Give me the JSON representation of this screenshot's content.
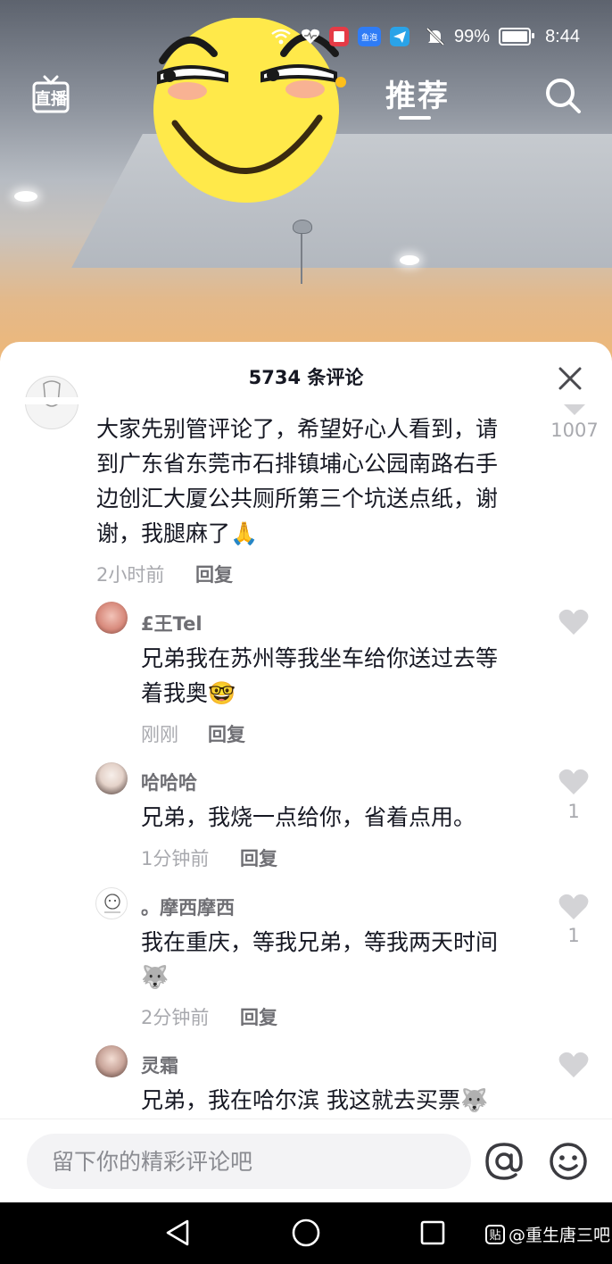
{
  "status_bar": {
    "battery": "99%",
    "time": "8:44"
  },
  "top_nav": {
    "live_label": "直播",
    "recommend_tab": "推荐"
  },
  "sheet": {
    "title": "5734 条评论"
  },
  "comments": [
    {
      "text_lines": [
        "大家先别管评论了，希望好心人看到，请",
        "到广东省东莞市石排镇埔心公园南路右手",
        "边创汇大厦公共厕所第三个坑送点纸，谢",
        "谢，我腿麻了🙏"
      ],
      "time": "2小时前",
      "reply_label": "回复",
      "likes": "1007"
    }
  ],
  "replies": [
    {
      "username": "£王Tel",
      "text_lines": [
        "兄弟我在苏州等我坐车给你送过去等",
        "着我奥🤓"
      ],
      "time": "刚刚",
      "reply_label": "回复",
      "likes": ""
    },
    {
      "username": "哈哈哈",
      "text_lines": [
        "兄弟，我烧一点给你，省着点用。"
      ],
      "time": "1分钟前",
      "reply_label": "回复",
      "likes": "1"
    },
    {
      "username": "。摩西摩西",
      "text_lines": [
        "我在重庆，等我兄弟，等我两天时间",
        "🐺"
      ],
      "time": "2分钟前",
      "reply_label": "回复",
      "likes": "1"
    },
    {
      "username": "灵霜",
      "text_lines": [
        "兄弟，我在哈尔滨 我这就去买票🐺"
      ],
      "time": "",
      "reply_label": "",
      "likes": ""
    }
  ],
  "input": {
    "placeholder": "留下你的精彩评论吧"
  },
  "watermark": {
    "logo": "贴",
    "text": "@重生唐三吧"
  },
  "icons": [
    "wifi-icon",
    "heart-rate-icon",
    "book-app-icon",
    "fish-app-icon",
    "paper-plane-icon",
    "mute-icon",
    "battery-icon",
    "live-icon",
    "search-icon",
    "close-icon",
    "heart-icon",
    "at-icon",
    "emoji-icon",
    "nav-back-icon",
    "nav-home-icon",
    "nav-recent-icon"
  ],
  "colors": {
    "accent_like_gray": "#d3d3d6",
    "text_primary": "#161823",
    "text_secondary": "#a8a9ae",
    "sticker_yellow": "#ffe94a"
  }
}
